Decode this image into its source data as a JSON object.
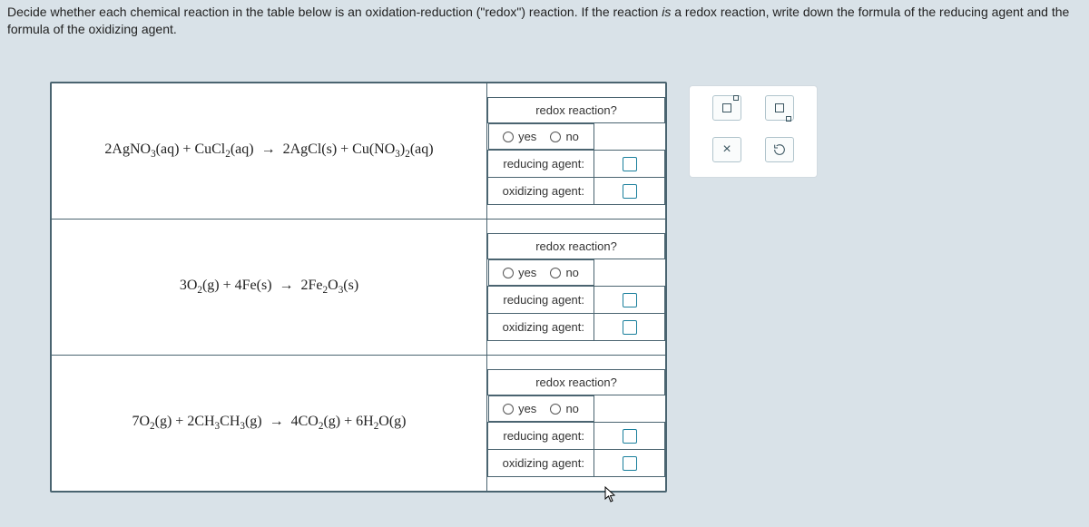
{
  "instructions": {
    "pre": "Decide whether each chemical reaction in the table below is an oxidation-reduction (\"redox\") reaction. If the reaction ",
    "ital": "is",
    "post": " a redox reaction, write down the formula of the reducing agent and the formula of the oxidizing agent."
  },
  "labels": {
    "header": "redox reaction?",
    "yes": "yes",
    "no": "no",
    "reducing": "reducing agent:",
    "oxidizing": "oxidizing agent:"
  },
  "reactions": {
    "r1": "2AgNO₃(aq) + CuCl₂(aq) → 2AgCl(s) + Cu(NO₃)₂(aq)",
    "r2": "3O₂(g) + 4Fe(s) → 2Fe₂O₃(s)",
    "r3": "7O₂(g) + 2CH₃CH₃(g) → 4CO₂(g) + 6H₂O(g)"
  },
  "sidekeys": {
    "sup": "□",
    "sub": "□",
    "close": "×",
    "reset": "↺"
  },
  "chart_data": [
    {
      "type": "table",
      "title": "Redox reaction classification",
      "columns": [
        "reaction",
        "redox?",
        "reducing agent",
        "oxidizing agent"
      ],
      "rows": [
        {
          "reaction": "2AgNO3(aq) + CuCl2(aq) → 2AgCl(s) + Cu(NO3)2(aq)",
          "redox?": "",
          "reducing agent": "",
          "oxidizing agent": ""
        },
        {
          "reaction": "3O2(g) + 4Fe(s) → 2Fe2O3(s)",
          "redox?": "",
          "reducing agent": "",
          "oxidizing agent": ""
        },
        {
          "reaction": "7O2(g) + 2CH3CH3(g) → 4CO2(g) + 6H2O(g)",
          "redox?": "",
          "reducing agent": "",
          "oxidizing agent": ""
        }
      ]
    }
  ]
}
